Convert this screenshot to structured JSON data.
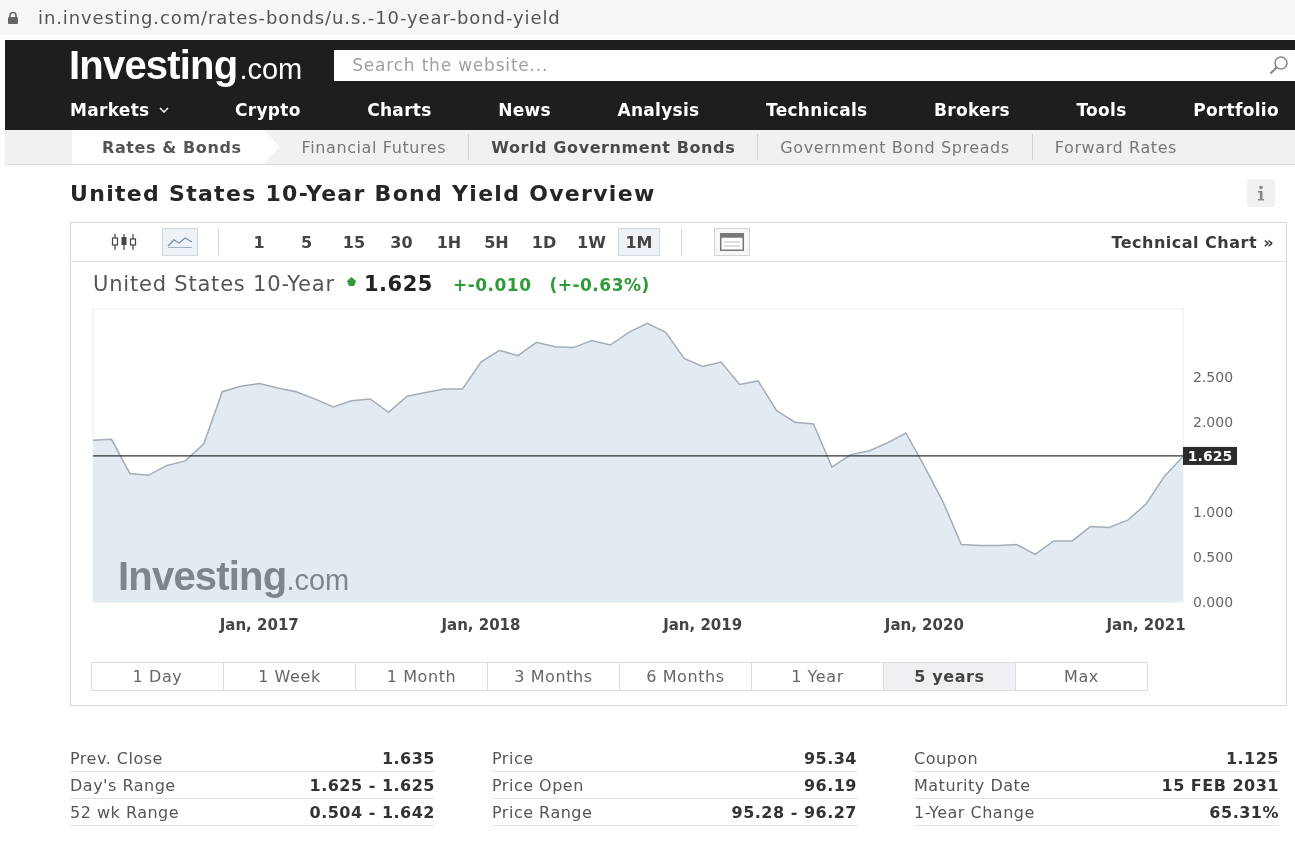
{
  "address_bar": {
    "url": "in.investing.com/rates-bonds/u.s.-10-year-bond-yield"
  },
  "header": {
    "logo": {
      "name": "Investing",
      "suffix": ".com"
    },
    "search": {
      "placeholder": "Search the website..."
    },
    "nav": [
      {
        "label": "Markets",
        "has_menu": true
      },
      {
        "label": "Crypto",
        "has_menu": false
      },
      {
        "label": "Charts",
        "has_menu": false
      },
      {
        "label": "News",
        "has_menu": false
      },
      {
        "label": "Analysis",
        "has_menu": false
      },
      {
        "label": "Technicals",
        "has_menu": false
      },
      {
        "label": "Brokers",
        "has_menu": false
      },
      {
        "label": "Tools",
        "has_menu": false
      },
      {
        "label": "Portfolio",
        "has_menu": false
      }
    ]
  },
  "subnav": [
    {
      "label": "Rates & Bonds",
      "selected": true,
      "highlighted": false
    },
    {
      "label": "Financial Futures",
      "selected": false,
      "highlighted": false
    },
    {
      "label": "World Government Bonds",
      "selected": false,
      "highlighted": true
    },
    {
      "label": "Government Bond Spreads",
      "selected": false,
      "highlighted": false
    },
    {
      "label": "Forward Rates",
      "selected": false,
      "highlighted": false
    }
  ],
  "page_title": "United States 10-Year Bond Yield Overview",
  "chart": {
    "chart_types": [
      {
        "kind": "candlestick",
        "selected": false
      },
      {
        "kind": "line",
        "selected": true
      }
    ],
    "intervals": [
      {
        "label": "1",
        "selected": false
      },
      {
        "label": "5",
        "selected": false
      },
      {
        "label": "15",
        "selected": false
      },
      {
        "label": "30",
        "selected": false
      },
      {
        "label": "1H",
        "selected": false
      },
      {
        "label": "5H",
        "selected": false
      },
      {
        "label": "1D",
        "selected": false
      },
      {
        "label": "1W",
        "selected": false
      },
      {
        "label": "1M",
        "selected": true
      }
    ],
    "technical_link": "Technical Chart »",
    "quote": {
      "name": "United States 10-Year",
      "last": "1.625",
      "change": "+-0.010",
      "change_pct": "(+-0.63%)"
    },
    "logo": {
      "name": "Investing",
      "suffix": ".com"
    },
    "chart_data": {
      "type": "area",
      "categories": [
        null,
        null,
        null,
        null,
        null,
        null,
        null,
        null,
        null,
        "Jan, 2017",
        null,
        null,
        null,
        null,
        null,
        null,
        null,
        null,
        null,
        null,
        null,
        "Jan, 2018",
        null,
        null,
        null,
        null,
        null,
        null,
        null,
        null,
        null,
        null,
        null,
        "Jan, 2019",
        null,
        null,
        null,
        null,
        null,
        null,
        null,
        null,
        null,
        null,
        null,
        "Jan, 2020",
        null,
        null,
        null,
        null,
        null,
        null,
        null,
        null,
        null,
        null,
        null,
        "Jan, 2021",
        null,
        null
      ],
      "series": [
        {
          "color": "#a3adb7",
          "values": [
            1.8,
            1.81,
            1.43,
            1.41,
            1.52,
            1.57,
            1.76,
            2.34,
            2.4,
            2.43,
            2.38,
            2.34,
            2.26,
            2.17,
            2.24,
            2.26,
            2.11,
            2.29,
            2.33,
            2.37,
            2.37,
            2.67,
            2.8,
            2.74,
            2.89,
            2.84,
            2.83,
            2.91,
            2.86,
            3.0,
            3.1,
            3.0,
            2.71,
            2.62,
            2.67,
            2.42,
            2.46,
            2.13,
            2.0,
            1.98,
            1.5,
            1.64,
            1.68,
            1.77,
            1.88,
            1.51,
            1.12,
            0.64,
            0.63,
            0.63,
            0.64,
            0.53,
            0.68,
            0.68,
            0.84,
            0.83,
            0.91,
            1.09,
            1.4,
            1.62
          ]
        }
      ],
      "ylim": [
        0,
        3.26
      ],
      "yticks": [
        {
          "value": 0,
          "label": "0.000"
        },
        {
          "value": 0.5,
          "label": "0.500"
        },
        {
          "value": 1,
          "label": "1.000"
        },
        {
          "value": 2,
          "label": "2.000"
        },
        {
          "value": 2.5,
          "label": "2.500"
        }
      ],
      "ref_lines": [
        {
          "axis": "y",
          "value": 1.625,
          "label": "1.625"
        }
      ]
    },
    "ranges": [
      {
        "label": "1 Day",
        "selected": false
      },
      {
        "label": "1 Week",
        "selected": false
      },
      {
        "label": "1 Month",
        "selected": false
      },
      {
        "label": "3 Months",
        "selected": false
      },
      {
        "label": "6 Months",
        "selected": false
      },
      {
        "label": "1 Year",
        "selected": false
      },
      {
        "label": "5 years",
        "selected": true
      },
      {
        "label": "Max",
        "selected": false
      }
    ]
  },
  "stats": [
    [
      {
        "label": "Prev. Close",
        "value": "1.635"
      },
      {
        "label": "Day's Range",
        "value": "1.625 - 1.625"
      },
      {
        "label": "52 wk Range",
        "value": "0.504 - 1.642"
      }
    ],
    [
      {
        "label": "Price",
        "value": "95.34"
      },
      {
        "label": "Price Open",
        "value": "96.19"
      },
      {
        "label": "Price Range",
        "value": "95.28 - 96.27"
      }
    ],
    [
      {
        "label": "Coupon",
        "value": "1.125"
      },
      {
        "label": "Maturity Date",
        "value": "15 FEB 2031"
      },
      {
        "label": "1-Year Change",
        "value": "65.31%"
      }
    ]
  ]
}
